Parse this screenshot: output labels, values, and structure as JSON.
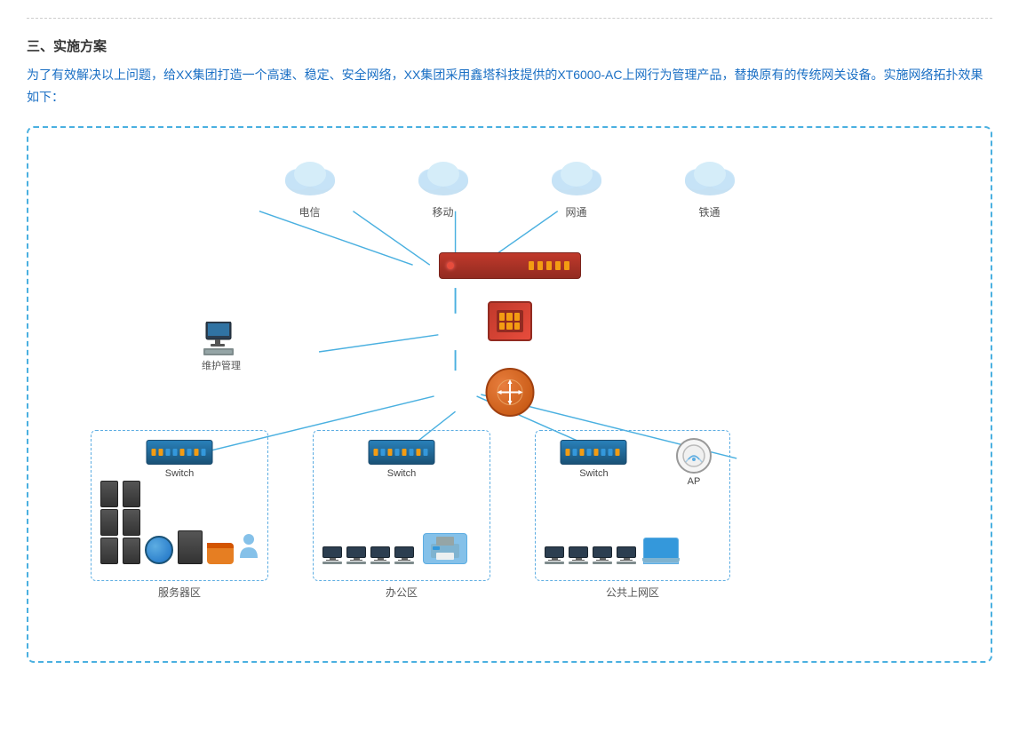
{
  "page": {
    "section_number": "三、实施方案",
    "description": "为了有效解决以上问题，给XX集团打造一个高速、稳定、安全网络，XX集团采用鑫塔科技提供的XT6000-AC上网行为管理产品，替换原有的传统网关设备。实施网络拓扑效果如下："
  },
  "diagram": {
    "isp_labels": [
      "电信",
      "移动",
      "网通",
      "铁通"
    ],
    "maintenance_label": "维护管理",
    "switches": {
      "servers_zone": "Switch",
      "office_zone": "Switch",
      "public_zone": "Switch"
    },
    "ap_label": "AP",
    "zones": {
      "servers": "服务器区",
      "office": "办公区",
      "public": "公共上网区"
    }
  }
}
